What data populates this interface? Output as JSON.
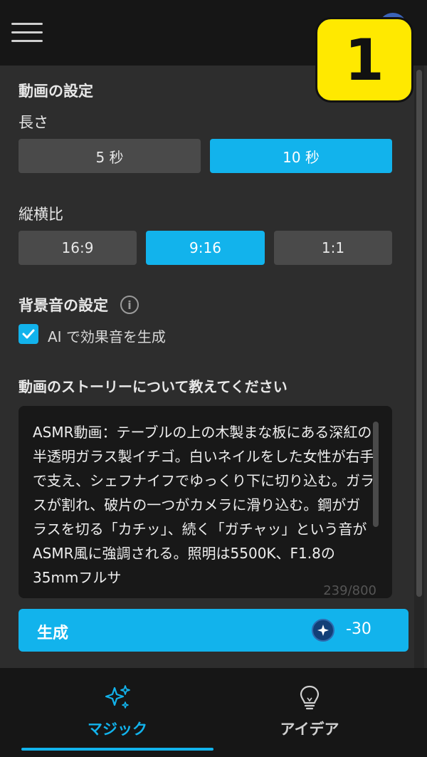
{
  "step_badge": "1",
  "video_settings": {
    "title": "動画の設定",
    "length_label": "長さ",
    "length_options": [
      "5 秒",
      "10 秒"
    ],
    "length_selected": "10 秒",
    "aspect_label": "縦横比",
    "aspect_options": [
      "16:9",
      "9:16",
      "1:1"
    ],
    "aspect_selected": "9:16"
  },
  "background_sound": {
    "title": "背景音の設定",
    "info_icon": "info-icon",
    "checkbox_label": "AI で効果音を生成",
    "checked": true
  },
  "story": {
    "title": "動画のストーリーについて教えてください",
    "text": "ASMR動画：テーブルの上の木製まな板にある深紅の半透明ガラス製イチゴ。白いネイルをした女性が右手で支え、シェフナイフでゆっくり下に切り込む。ガラスが割れ、破片の一つがカメラに滑り込む。鋼がガラスを切る「カチッ」、続く「ガチャッ」という音がASMR風に強調される。照明は5500K、F1.8の35mmフルサ",
    "char_count": "239/800"
  },
  "generate": {
    "label": "生成",
    "credit_icon": "sparkle-credit-icon",
    "credit_cost": "-30"
  },
  "bottom_nav": {
    "items": [
      {
        "label": "マジック",
        "icon": "sparkles-icon",
        "active": true
      },
      {
        "label": "アイデア",
        "icon": "lightbulb-icon",
        "active": false
      }
    ]
  },
  "colors": {
    "accent": "#12b3ec",
    "badge": "#ffe900",
    "panel": "#2d2d2d",
    "button_inactive": "#4a4a4a"
  }
}
